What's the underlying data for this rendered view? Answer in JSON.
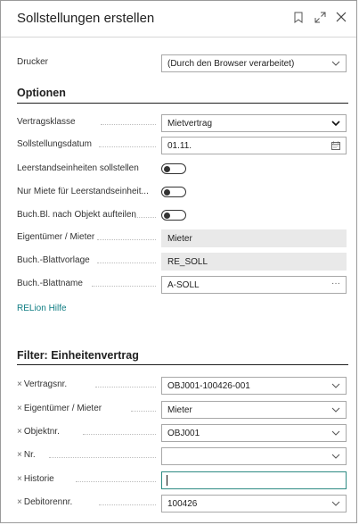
{
  "dialog": {
    "title": "Sollstellungen erstellen",
    "icons": [
      "bookmark-icon",
      "expand-icon",
      "close-icon"
    ]
  },
  "printer": {
    "label": "Drucker",
    "value": "(Durch den Browser verarbeitet)"
  },
  "options": {
    "heading": "Optionen",
    "vertragsklasse": {
      "label": "Vertragsklasse",
      "value": "Mietvertrag"
    },
    "sollstellungsdatum": {
      "label": "Sollstellungsdatum",
      "value": "01.11."
    },
    "leerstand": {
      "label": "Leerstandseinheiten sollstellen",
      "on": false
    },
    "nur_miete": {
      "label": "Nur Miete für Leerstandseinheit...",
      "on": false
    },
    "buch_bl": {
      "label": "Buch.Bl. nach Objekt aufteilen",
      "on": false
    },
    "eigentuemer": {
      "label": "Eigentümer / Mieter",
      "value": "Mieter"
    },
    "blattvorlage": {
      "label": "Buch.-Blattvorlage",
      "value": "RE_SOLL"
    },
    "blattname": {
      "label": "Buch.-Blattname",
      "value": "A-SOLL",
      "more": "···"
    },
    "help_link": "RELion Hilfe"
  },
  "filter": {
    "heading": "Filter: Einheitenvertrag",
    "remove_symbol": "×",
    "rows": [
      {
        "label": "Vertragsnr.",
        "value": "OBJ001-100426-001"
      },
      {
        "label": "Eigentümer / Mieter",
        "value": "Mieter"
      },
      {
        "label": "Objektnr.",
        "value": "OBJ001"
      },
      {
        "label": "Nr.",
        "value": ""
      },
      {
        "label": "Historie",
        "value": ""
      },
      {
        "label": "Debitorennr.",
        "value": "100426"
      }
    ]
  },
  "colors": {
    "accent": "#2e8b83",
    "link": "#0f7d83"
  }
}
